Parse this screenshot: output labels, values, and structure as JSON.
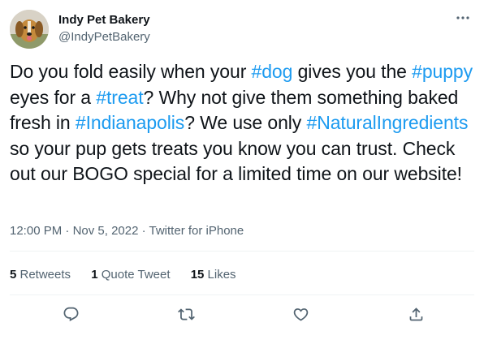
{
  "author": {
    "display_name": "Indy Pet Bakery",
    "handle": "@IndyPetBakery"
  },
  "tweet": {
    "segments": [
      {
        "text": "Do you fold easily when your ",
        "hashtag": false
      },
      {
        "text": "#dog",
        "hashtag": true
      },
      {
        "text": " gives you the ",
        "hashtag": false
      },
      {
        "text": "#puppy",
        "hashtag": true
      },
      {
        "text": " eyes for a ",
        "hashtag": false
      },
      {
        "text": "#treat",
        "hashtag": true
      },
      {
        "text": "? Why not give them something baked fresh in ",
        "hashtag": false
      },
      {
        "text": "#Indianapolis",
        "hashtag": true
      },
      {
        "text": "? We use only ",
        "hashtag": false
      },
      {
        "text": "#NaturalIngredients",
        "hashtag": true
      },
      {
        "text": " so your pup gets treats you know you can trust. Check out our BOGO special for a limited time on our website!",
        "hashtag": false
      }
    ]
  },
  "meta": {
    "time": "12:00 PM",
    "separator": " · ",
    "date": "Nov 5, 2022",
    "source": "Twitter for iPhone"
  },
  "stats": {
    "retweets_count": "5",
    "retweets_label": " Retweets",
    "quotes_count": "1",
    "quotes_label": " Quote Tweet",
    "likes_count": "15",
    "likes_label": " Likes"
  },
  "icons": {
    "more": "more-dots-icon",
    "reply": "reply-icon",
    "retweet": "retweet-icon",
    "like": "heart-icon",
    "share": "share-icon"
  },
  "colors": {
    "hashtag": "#1d9bf0",
    "secondary_text": "#536471",
    "primary_text": "#0f1419"
  }
}
